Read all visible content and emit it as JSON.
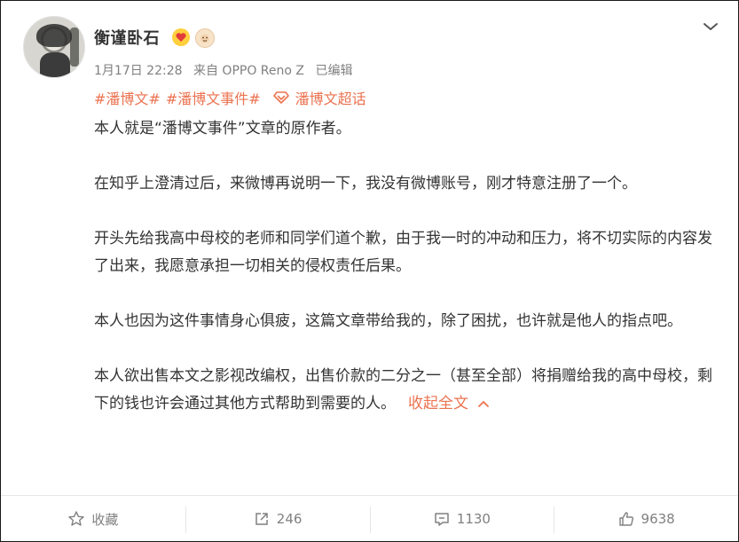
{
  "author": {
    "name": "衡谨卧石",
    "badges": [
      "fire-heart-badge",
      "monkey-face-badge"
    ]
  },
  "post_meta": {
    "time": "1月17日 22:28",
    "source": "来自 OPPO Reno Z",
    "edited": "已编辑"
  },
  "topics": {
    "tag1": "#潘博文#",
    "tag2": "#潘博文事件#",
    "super_topic": "潘博文超话"
  },
  "content": {
    "p1": "本人就是“潘博文事件”文章的原作者。",
    "p2": "在知乎上澄清过后，来微博再说明一下，我没有微博账号，刚才特意注册了一个。",
    "p3": "开头先给我高中母校的老师和同学们道个歉，由于我一时的冲动和压力，将不切实际的内容发了出来，我愿意承担一切相关的侵权责任后果。",
    "p4": "本人也因为这件事情身心俱疲，这篇文章带给我的，除了困扰，也许就是他人的指点吧。",
    "p5": "本人欲出售本文之影视改编权，出售价款的二分之一（甚至全部）将捐赠给我的高中母校，剩下的钱也许会通过其他方式帮助到需要的人。",
    "collapse_label": "收起全文"
  },
  "toolbar": {
    "favorite_label": "收藏",
    "repost_count": "246",
    "comment_count": "1130",
    "like_count": "9638"
  },
  "colors": {
    "accent": "#eb7350",
    "meta_gray": "#808080",
    "text": "#333333"
  }
}
